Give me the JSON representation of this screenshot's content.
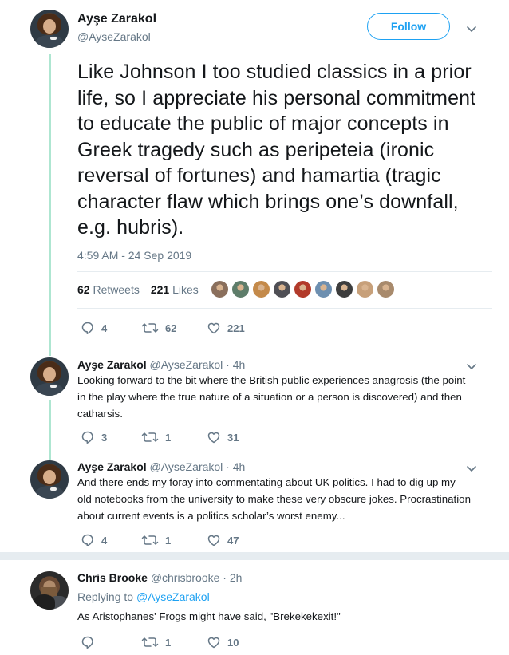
{
  "main_tweet": {
    "author_name": "Ayşe Zarakol",
    "author_handle": "@AyseZarakol",
    "follow_label": "Follow",
    "text": "Like Johnson I too studied classics in a prior life, so I appreciate his personal commitment to educate the public of major concepts in Greek tragedy such as peripeteia (ironic reversal of fortunes) and hamartia (tragic character flaw which brings one’s downfall, e.g. hubris).",
    "timestamp": "4:59 AM - 24 Sep 2019",
    "retweets_count": "62",
    "retweets_label": "Retweets",
    "likes_count": "221",
    "likes_label": "Likes",
    "actions": {
      "replies": "4",
      "retweets": "62",
      "likes": "221"
    }
  },
  "replies": [
    {
      "author_name": "Ayşe Zarakol",
      "author_handle": "@AyseZarakol · 4h",
      "text": "Looking forward to the bit where the British public experiences anagrosis (the point in the play where the true nature of a situation or a person is discovered) and then catharsis.",
      "actions": {
        "replies": "3",
        "retweets": "1",
        "likes": "31"
      }
    },
    {
      "author_name": "Ayşe Zarakol",
      "author_handle": "@AyseZarakol · 4h",
      "text": "And there ends my foray into commentating about UK politics. I had to dig up my old notebooks from the university to make these very obscure jokes. Procrastination about current events is a politics scholar’s worst enemy...",
      "actions": {
        "replies": "4",
        "retweets": "1",
        "likes": "47"
      }
    }
  ],
  "other_reply": {
    "author_name": "Chris Brooke",
    "author_handle": "@chrisbrooke · 2h",
    "replying_prefix": "Replying to",
    "replying_to": "@AyseZarakol",
    "text": "As Aristophanes' Frogs might have said, \"Brekekekexit!\"",
    "actions": {
      "replies": "",
      "retweets": "1",
      "likes": "10"
    }
  },
  "colors": {
    "accent": "#1da1f2",
    "thread_line": "#aee6d1",
    "secondary_text": "#657786",
    "like_heart": "#657786"
  },
  "liker_avatar_colors": [
    "#8a6f5c",
    "#5e7d6a",
    "#c48a4a",
    "#4f4f55",
    "#b23a2a",
    "#6d8fb0",
    "#3d3d3d",
    "#c7a07a",
    "#a88a6c"
  ]
}
